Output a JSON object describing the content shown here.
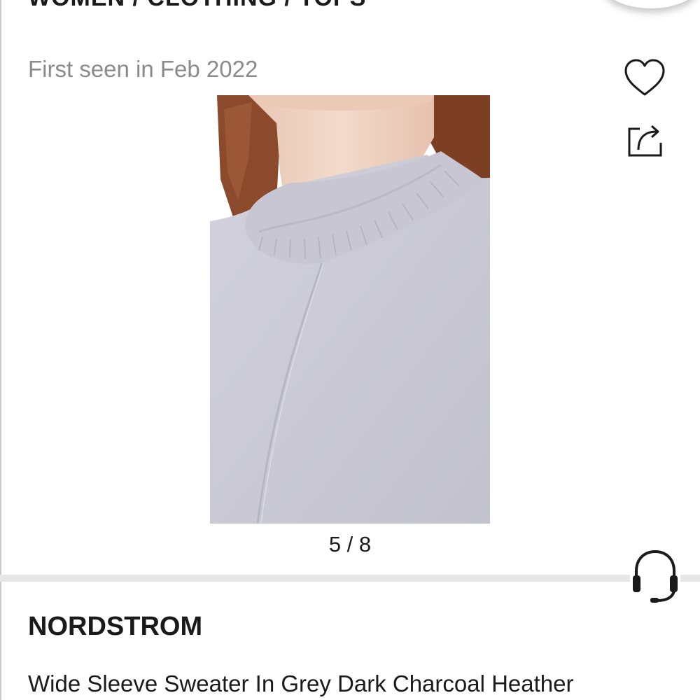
{
  "header": {
    "breadcrumb": "WOMEN / CLOTHING / TOPS",
    "first_seen": "First seen in Feb 2022"
  },
  "actions": {
    "favorite_icon": "heart-icon",
    "share_icon": "share-icon",
    "support_icon": "headset-icon"
  },
  "gallery": {
    "counter": "5 / 8",
    "current_image": 5,
    "total_images": 8
  },
  "product": {
    "brand": "NORDSTROM",
    "title": "Wide Sleeve Sweater In Grey Dark Charcoal Heather"
  },
  "colors": {
    "text": "#1a1a1a",
    "muted_text": "#8a8a8a",
    "divider": "#e6e6e6",
    "sweater": "#c9c8d4",
    "hair": "#8c4a2c",
    "skin": "#efd3c2"
  }
}
